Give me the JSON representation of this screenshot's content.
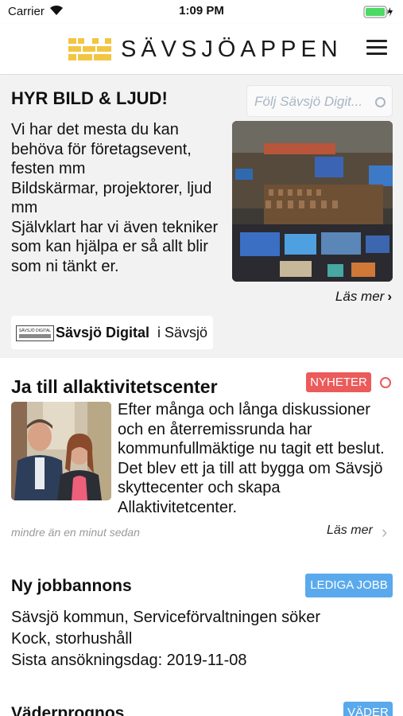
{
  "status": {
    "carrier": "Carrier",
    "time": "1:09 PM"
  },
  "header": {
    "title": "SÄVSJÖAPPEN"
  },
  "ad": {
    "title": "HYR BILD & LJUD!",
    "follow_label": "Följ Sävsjö Digit...",
    "body": "Vi har det mesta du kan behöva för företagsevent, festen mm\nBildskärmar, projektorer, ljud mm\nSjälvklart har vi även tekniker som kan hjälpa er så allt blir som ni tänkt er.\n\nKontakta oss så",
    "read_more": "Läs mer",
    "brand_logo_text": "SÄVSJÖ DIGITAL",
    "brand_name": "Sävsjö Digital",
    "brand_place": "i Sävsjö"
  },
  "news": {
    "title": "Ja till allaktivitetscenter",
    "tag": "NYHETER",
    "body": "Efter många och långa diskussioner och en återremissrunda har kommunfullmäktige nu tagit ett beslut. Det blev ett ja till att bygga om Sävsjö skyttecenter och skapa Allaktivitetcenter.",
    "time": "mindre än en minut sedan",
    "read_more": "Läs mer"
  },
  "job": {
    "title": "Ny jobbannons",
    "tag": "LEDIGA JOBB",
    "body": "Sävsjö kommun, Serviceförvaltningen söker\nKock, storhushåll\nSista ansökningsdag: 2019-11-08"
  },
  "weather": {
    "title": "Väderprognos",
    "tag": "VÄDER"
  },
  "colors": {
    "news_tag": "#ec5a5a",
    "job_tag": "#5aa9ec",
    "logo": "#f2c542",
    "battery": "#4cd964"
  }
}
